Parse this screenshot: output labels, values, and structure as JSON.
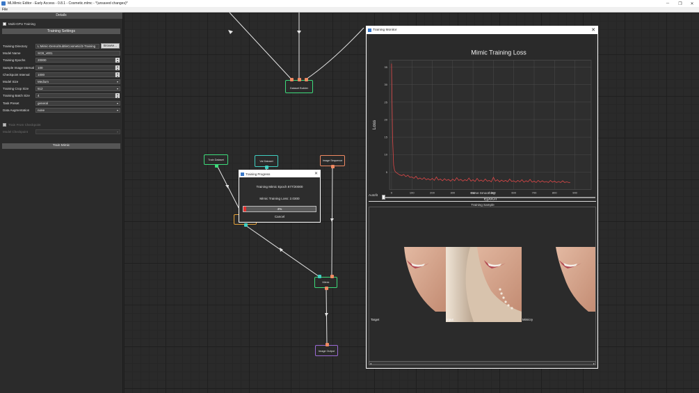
{
  "window": {
    "title": "MLMimic Editor - Early Access - 0.8.1 - Cosmetic.mlmc - *(unsaved changes)*",
    "minimize": "─",
    "maximize": "❐",
    "close": "✕"
  },
  "menu": {
    "file": "File"
  },
  "details": {
    "header": "Details",
    "multi_gpu": "Multi-GPU Training",
    "section": "Training Settings",
    "fields": [
      {
        "label": "Training Directory",
        "value": "L:Mimic-Demo/SubtleCosmetic/3-Training"
      },
      {
        "label": "Model Name",
        "value": "SCB_v001"
      },
      {
        "label": "Training Epochs",
        "value": "20000"
      },
      {
        "label": "Sample Image Interval",
        "value": "100"
      },
      {
        "label": "Checkpoint Interval",
        "value": "1000"
      },
      {
        "label": "Model Size",
        "value": "Medium"
      },
      {
        "label": "Training Crop Size",
        "value": "512"
      },
      {
        "label": "Training Batch Size",
        "value": "4"
      },
      {
        "label": "Task Preset",
        "value": "general"
      },
      {
        "label": "Data Augmentation",
        "value": "none"
      }
    ],
    "browse": "Browse...",
    "train_from_checkpoint": "Train From Checkpoint",
    "model_checkpoint": "Model Checkpoint",
    "train_button": "Train Mimic"
  },
  "nodes": {
    "dataset_builder": "Dataset Builder",
    "train_dataset": "Train Dataset",
    "val_dataset": "Val Dataset",
    "image_sequence": "Image Sequence",
    "mimic": "Mimic",
    "image_output": "Image Output"
  },
  "progress": {
    "title": "Training Progress",
    "epoch_line": "Training Mimic Epoch 877/20000",
    "loss_line": "Mimic Training Loss: 2.0300",
    "percent": 4,
    "percent_label": "4%",
    "cancel": "Cancel"
  },
  "monitor": {
    "title": "Training Monitor",
    "autofit": "Autofit",
    "curve_smoothing": "Curve Smoothing",
    "sample_header": "Training Sample",
    "labels": {
      "target": "Target",
      "input": "Input",
      "mimicry": "Mimicry"
    }
  },
  "colors": {
    "accent_orange": "#f08a63",
    "accent_cyan": "#41d1c3",
    "accent_green": "#3ddc7b",
    "progress_red": "#e2322f",
    "loss_line": "#e04848"
  },
  "chart_data": {
    "type": "line",
    "title": "Mimic Training Loss",
    "xlabel": "Epoch",
    "ylabel": "Loss",
    "xlim": [
      -10,
      980
    ],
    "ylim": [
      0,
      37
    ],
    "xticks": [
      0,
      100,
      200,
      300,
      400,
      500,
      600,
      700,
      800,
      900
    ],
    "yticks": [
      5,
      10,
      15,
      20,
      25,
      30,
      35
    ],
    "grid": true,
    "series": [
      {
        "values": [
          [
            0,
            36.0
          ],
          [
            5,
            15.0
          ],
          [
            10,
            7.0
          ],
          [
            15,
            5.5
          ],
          [
            20,
            5.0
          ],
          [
            30,
            4.6
          ],
          [
            40,
            4.2
          ],
          [
            50,
            4.0
          ],
          [
            60,
            4.3
          ],
          [
            70,
            3.7
          ],
          [
            80,
            4.1
          ],
          [
            90,
            3.5
          ],
          [
            100,
            3.6
          ],
          [
            110,
            3.2
          ],
          [
            120,
            3.8
          ],
          [
            130,
            3.0
          ],
          [
            140,
            3.3
          ],
          [
            150,
            2.9
          ],
          [
            160,
            3.4
          ],
          [
            170,
            2.8
          ],
          [
            180,
            3.1
          ],
          [
            190,
            2.7
          ],
          [
            200,
            3.2
          ],
          [
            210,
            2.6
          ],
          [
            220,
            3.6
          ],
          [
            230,
            2.7
          ],
          [
            240,
            3.0
          ],
          [
            250,
            2.5
          ],
          [
            260,
            3.1
          ],
          [
            270,
            2.6
          ],
          [
            280,
            2.9
          ],
          [
            290,
            2.4
          ],
          [
            300,
            3.0
          ],
          [
            310,
            2.5
          ],
          [
            320,
            3.4
          ],
          [
            330,
            2.6
          ],
          [
            340,
            2.9
          ],
          [
            350,
            2.4
          ],
          [
            360,
            2.8
          ],
          [
            370,
            2.5
          ],
          [
            380,
            3.3
          ],
          [
            390,
            2.4
          ],
          [
            400,
            2.8
          ],
          [
            410,
            2.3
          ],
          [
            420,
            3.2
          ],
          [
            430,
            2.4
          ],
          [
            440,
            2.7
          ],
          [
            450,
            2.3
          ],
          [
            460,
            3.0
          ],
          [
            470,
            2.4
          ],
          [
            480,
            2.6
          ],
          [
            490,
            2.2
          ],
          [
            500,
            3.5
          ],
          [
            510,
            2.4
          ],
          [
            520,
            2.8
          ],
          [
            530,
            2.2
          ],
          [
            540,
            2.7
          ],
          [
            550,
            2.3
          ],
          [
            560,
            2.6
          ],
          [
            570,
            2.2
          ],
          [
            580,
            3.0
          ],
          [
            590,
            2.3
          ],
          [
            600,
            2.5
          ],
          [
            610,
            2.1
          ],
          [
            620,
            2.6
          ],
          [
            630,
            2.2
          ],
          [
            640,
            2.8
          ],
          [
            650,
            2.1
          ],
          [
            660,
            2.5
          ],
          [
            670,
            2.2
          ],
          [
            680,
            2.9
          ],
          [
            690,
            2.1
          ],
          [
            700,
            2.4
          ],
          [
            710,
            2.0
          ],
          [
            720,
            2.6
          ],
          [
            730,
            2.1
          ],
          [
            740,
            2.5
          ],
          [
            750,
            2.1
          ],
          [
            760,
            2.3
          ],
          [
            770,
            2.0
          ],
          [
            780,
            2.6
          ],
          [
            790,
            2.1
          ],
          [
            800,
            2.4
          ],
          [
            810,
            2.0
          ],
          [
            820,
            2.3
          ],
          [
            830,
            2.0
          ],
          [
            840,
            2.5
          ],
          [
            850,
            2.0
          ],
          [
            860,
            2.2
          ],
          [
            870,
            2.0
          ],
          [
            877,
            2.03
          ]
        ]
      }
    ]
  }
}
